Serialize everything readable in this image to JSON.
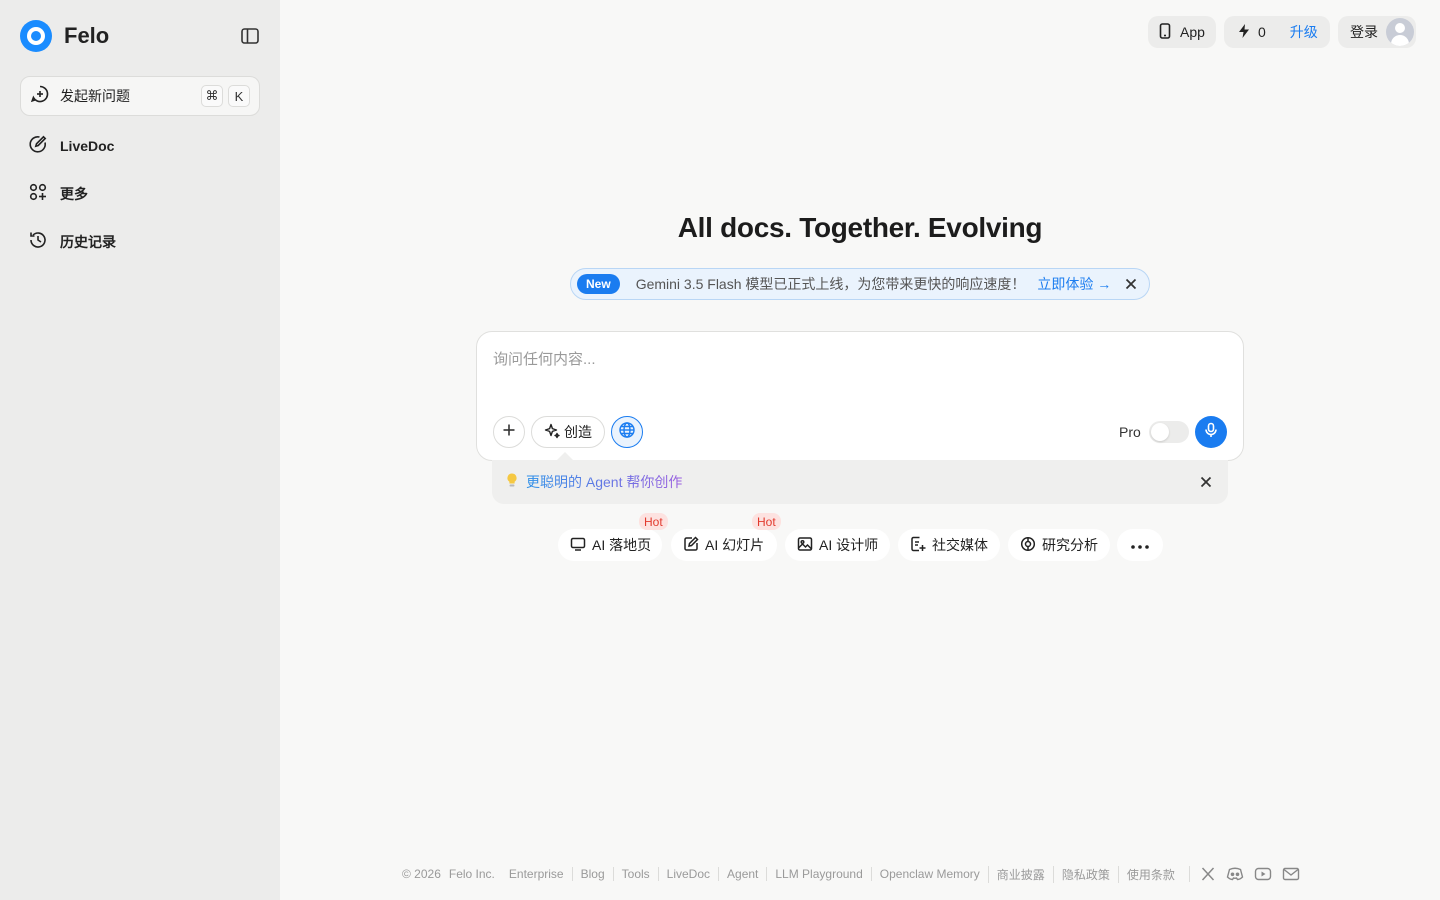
{
  "brand": {
    "name": "Felo"
  },
  "sidebar": {
    "new_question": {
      "label": "发起新问题",
      "shortcut_cmd": "⌘",
      "shortcut_key": "K"
    },
    "items": [
      {
        "label": "LiveDoc",
        "icon": "pen-circle-icon"
      },
      {
        "label": "更多",
        "icon": "grid-plus-icon"
      },
      {
        "label": "历史记录",
        "icon": "history-icon"
      }
    ]
  },
  "topbar": {
    "app_label": "App",
    "credits": "0",
    "upgrade_label": "升级",
    "login_label": "登录"
  },
  "hero": {
    "title": "All docs. Together. Evolving"
  },
  "banner": {
    "badge": "New",
    "text": "Gemini 3.5 Flash 模型已正式上线，为您带来更快的响应速度！",
    "link": "立即体验 →"
  },
  "composer": {
    "placeholder": "询问任何内容...",
    "create_label": "创造",
    "pro_label": "Pro",
    "pro_enabled": false
  },
  "tip": {
    "icon": "lightbulb-icon",
    "text": "更聪明的 Agent 帮你创作"
  },
  "chips": [
    {
      "label": "AI 落地页",
      "icon": "monitor-icon",
      "hot": true,
      "hot_label": "Hot"
    },
    {
      "label": "AI 幻灯片",
      "icon": "edit-doc-icon",
      "hot": true,
      "hot_label": "Hot"
    },
    {
      "label": "AI 设计师",
      "icon": "image-icon",
      "hot": false
    },
    {
      "label": "社交媒体",
      "icon": "doc-plus-icon",
      "hot": false
    },
    {
      "label": "研究分析",
      "icon": "research-icon",
      "hot": false
    }
  ],
  "footer": {
    "copyright": "© 2026",
    "company": "Felo Inc.",
    "links": [
      "Enterprise",
      "Blog",
      "Tools",
      "LiveDoc",
      "Agent",
      "LLM Playground",
      "Openclaw Memory",
      "商业披露",
      "隐私政策",
      "使用条款"
    ],
    "social": [
      "x-icon",
      "discord-icon",
      "youtube-icon",
      "mail-icon"
    ]
  },
  "colors": {
    "accent": "#1a7cf0",
    "sidebar_bg": "#ececeb",
    "page_bg": "#f8f8f7",
    "hot_text": "#e23a2e"
  }
}
